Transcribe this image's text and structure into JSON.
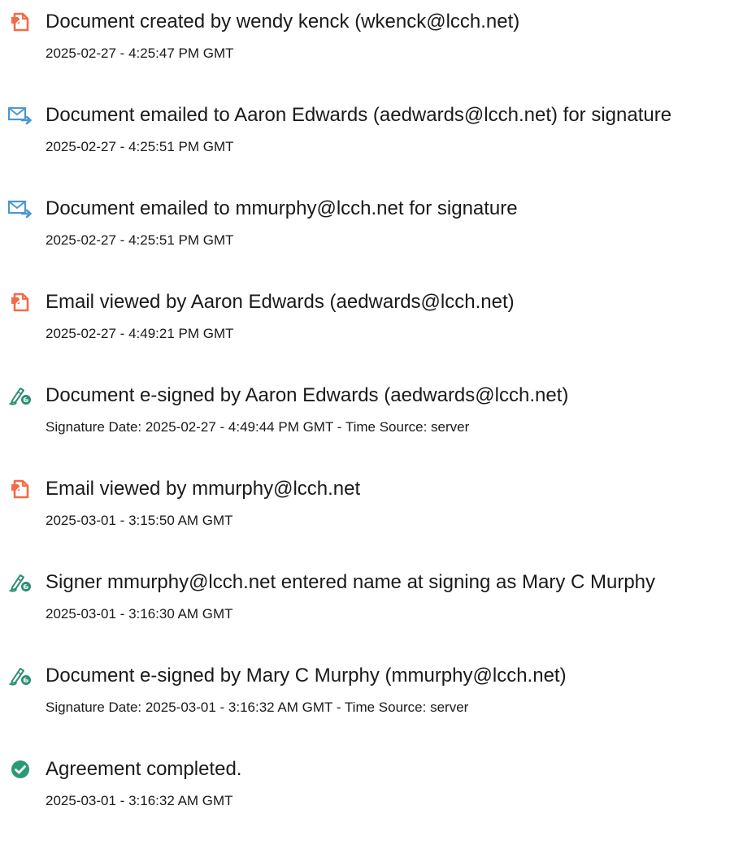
{
  "colors": {
    "doc_icon": "#f26b48",
    "email_icon": "#4a97d4",
    "esign_icon": "#2a8f72",
    "complete_icon": "#2a9a76"
  },
  "events": [
    {
      "icon": "document-icon",
      "title": "Document created by wendy kenck (wkenck@lcch.net)",
      "subtitle": "2025-02-27 - 4:25:47 PM GMT"
    },
    {
      "icon": "email-send-icon",
      "title": "Document emailed to Aaron Edwards (aedwards@lcch.net) for signature",
      "subtitle": "2025-02-27 - 4:25:51 PM GMT"
    },
    {
      "icon": "email-send-icon",
      "title": "Document emailed to mmurphy@lcch.net for signature",
      "subtitle": "2025-02-27 - 4:25:51 PM GMT"
    },
    {
      "icon": "document-icon",
      "title": "Email viewed by Aaron Edwards (aedwards@lcch.net)",
      "subtitle": "2025-02-27 - 4:49:21 PM GMT"
    },
    {
      "icon": "esign-pen-icon",
      "title": "Document e-signed by Aaron Edwards (aedwards@lcch.net)",
      "subtitle": "Signature Date: 2025-02-27 - 4:49:44 PM GMT - Time Source: server"
    },
    {
      "icon": "document-icon",
      "title": "Email viewed by mmurphy@lcch.net",
      "subtitle": "2025-03-01 - 3:15:50 AM GMT"
    },
    {
      "icon": "esign-pen-icon",
      "title": "Signer mmurphy@lcch.net entered name at signing as Mary C Murphy",
      "subtitle": "2025-03-01 - 3:16:30 AM GMT"
    },
    {
      "icon": "esign-pen-icon",
      "title": "Document e-signed by Mary C Murphy (mmurphy@lcch.net)",
      "subtitle": "Signature Date: 2025-03-01 - 3:16:32 AM GMT - Time Source: server"
    },
    {
      "icon": "check-circle-icon",
      "title": "Agreement completed.",
      "subtitle": "2025-03-01 - 3:16:32 AM GMT"
    }
  ]
}
